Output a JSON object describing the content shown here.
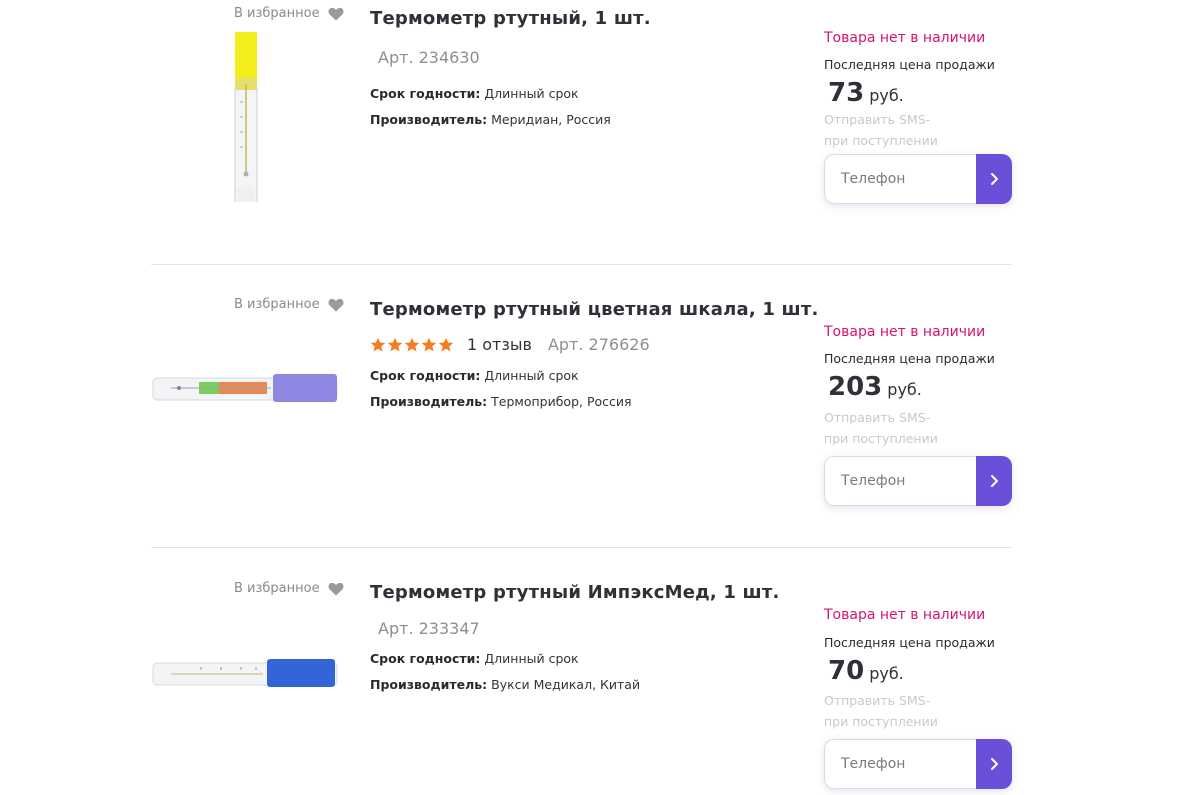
{
  "products": [
    {
      "favorite_label": "В избранное",
      "title": "Термометр ртутный, 1 шт.",
      "rating": null,
      "reviews": "",
      "article": "Арт. 234630",
      "expiry_label": "Срок годности:",
      "expiry_value": "Длинный срок",
      "maker_label": "Производитель:",
      "maker_value": "Меридиан, Россия",
      "stock_status": "Товара нет в наличии",
      "last_price_label": "Последняя цена продажи",
      "price": "73",
      "currency": "руб.",
      "sms_line1": "Отправить SMS-",
      "sms_line2": "при поступлении",
      "phone_placeholder": "Телефон"
    },
    {
      "favorite_label": "В избранное",
      "title": "Термометр ртутный цветная шкала, 1 шт.",
      "rating": 5,
      "reviews": "1 отзыв",
      "article": "Арт. 276626",
      "expiry_label": "Срок годности:",
      "expiry_value": "Длинный срок",
      "maker_label": "Производитель:",
      "maker_value": "Термоприбор, Россия",
      "stock_status": "Товара нет в наличии",
      "last_price_label": "Последняя цена продажи",
      "price": "203",
      "currency": "руб.",
      "sms_line1": "Отправить SMS-",
      "sms_line2": "при поступлении",
      "phone_placeholder": "Телефон"
    },
    {
      "favorite_label": "В избранное",
      "title": "Термометр ртутный ИмпэксМед, 1 шт.",
      "rating": null,
      "reviews": "",
      "article": "Арт. 233347",
      "expiry_label": "Срок годности:",
      "expiry_value": "Длинный срок",
      "maker_label": "Производитель:",
      "maker_value": "Вукси Медикал, Китай",
      "stock_status": "Товара нет в наличии",
      "last_price_label": "Последняя цена продажи",
      "price": "70",
      "currency": "руб.",
      "sms_line1": "Отправить SMS-",
      "sms_line2": "при поступлении",
      "phone_placeholder": "Телефон"
    }
  ],
  "colors": {
    "accent": "#6a4fd8",
    "stock_status": "#d4146e",
    "star": "#f57c1f",
    "heart": "#9a9a9a"
  },
  "icons": {
    "favorite": "heart-icon",
    "rating": "star-icon",
    "submit": "chevron-right-icon"
  }
}
